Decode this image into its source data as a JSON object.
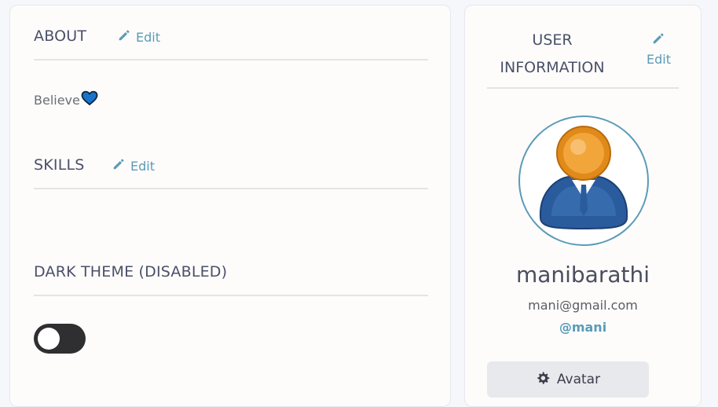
{
  "about": {
    "title": "ABOUT",
    "edit_label": "Edit",
    "text": "Believe",
    "emoji_icon": "blue-heart-icon"
  },
  "skills": {
    "title": "SKILLS",
    "edit_label": "Edit"
  },
  "theme": {
    "title": "DARK THEME (DISABLED)",
    "toggle_on": false
  },
  "user_info": {
    "title": "USER INFORMATION",
    "edit_label": "Edit",
    "name": "manibarathi",
    "email": "mani@gmail.com",
    "handle": "@mani",
    "avatar_button_label": "Avatar"
  },
  "colors": {
    "accent": "#5a9bb8",
    "text": "#4a5068",
    "toggle_off": "#2f2f31"
  }
}
